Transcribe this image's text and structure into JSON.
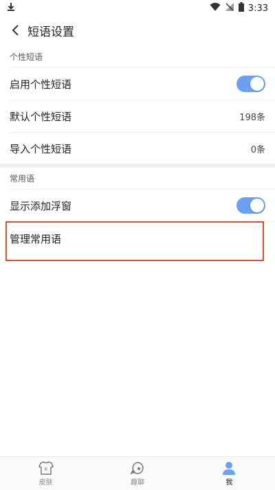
{
  "status_bar": {
    "time": "3:33"
  },
  "header": {
    "title": "短语设置"
  },
  "section_personal": {
    "label": "个性短语",
    "items": [
      {
        "label": "启用个性短语",
        "toggle_on": true
      },
      {
        "label": "默认个性短语",
        "value": "198条"
      },
      {
        "label": "导入个性短语",
        "value": "0条"
      }
    ]
  },
  "section_common": {
    "label": "常用语",
    "items": [
      {
        "label": "显示添加浮窗",
        "toggle_on": true
      },
      {
        "label": "管理常用语"
      }
    ]
  },
  "bottom_nav": [
    {
      "label": "皮肤",
      "icon": "shirt-icon",
      "active": false
    },
    {
      "label": "趣聊",
      "icon": "chat-icon",
      "active": false
    },
    {
      "label": "我",
      "icon": "person-icon",
      "active": true
    }
  ],
  "colors": {
    "accent": "#6aa1f2",
    "highlight": "#e24a2c"
  }
}
